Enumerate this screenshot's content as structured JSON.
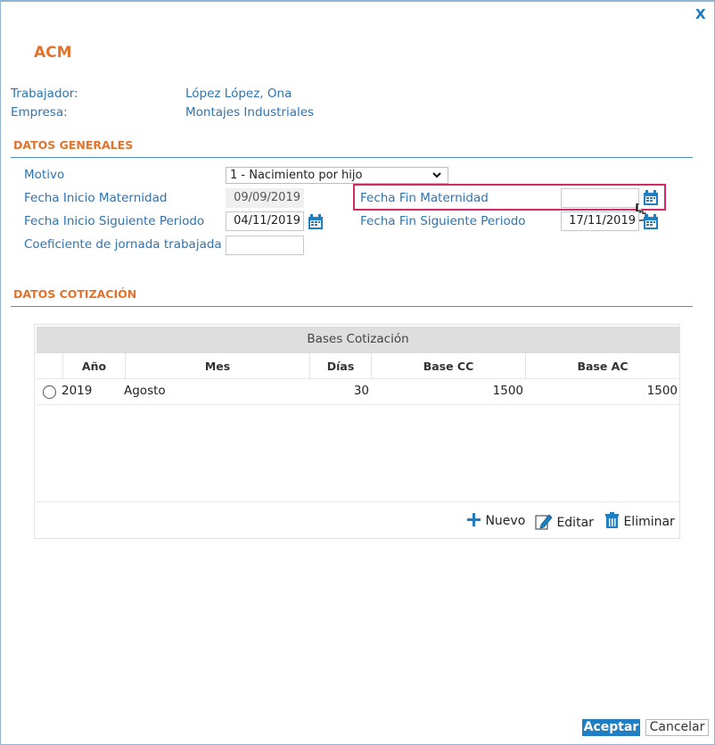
{
  "dialog": {
    "close_label": "X",
    "title": "ACM"
  },
  "info": {
    "worker_label": "Trabajador:",
    "worker_value": "López López, Ona",
    "company_label": "Empresa:",
    "company_value": "Montajes Industriales"
  },
  "general": {
    "section_title": "DATOS GENERALES",
    "motivo_label": "Motivo",
    "motivo_value": "1 - Nacimiento por hijo",
    "fecha_inicio_mat_label": "Fecha Inicio Maternidad",
    "fecha_inicio_mat_value": "09/09/2019",
    "fecha_fin_mat_label": "Fecha Fin Maternidad",
    "fecha_fin_mat_value": "",
    "fecha_inicio_sig_label": "Fecha Inicio Siguiente Periodo",
    "fecha_inicio_sig_value": "04/11/2019",
    "fecha_fin_sig_label": "Fecha Fin Siguiente Periodo",
    "fecha_fin_sig_value": "17/11/2019",
    "coef_label": "Coeficiente de jornada trabajada",
    "coef_value": ""
  },
  "cotizacion": {
    "section_title": "DATOS COTIZACIÓN",
    "table_title": "Bases Cotización",
    "columns": [
      "Año",
      "Mes",
      "Días",
      "Base CC",
      "Base AC"
    ],
    "rows": [
      {
        "anio": "2019",
        "mes": "Agosto",
        "dias": "30",
        "base_cc": "1500",
        "base_ac": "1500"
      }
    ],
    "actions": {
      "nuevo": "Nuevo",
      "editar": "Editar",
      "eliminar": "Eliminar"
    }
  },
  "footer": {
    "accept_label": "Aceptar",
    "cancel_label": "Cancelar"
  },
  "colors": {
    "accent_orange": "#e2732d",
    "label_blue": "#2d74b3",
    "button_blue": "#1f7fc2",
    "highlight_pink": "#d42a63"
  },
  "icons": [
    "close-icon",
    "calendar-icon",
    "plus-icon",
    "edit-icon",
    "trash-icon",
    "chevron-down-icon",
    "hand-cursor-icon"
  ]
}
